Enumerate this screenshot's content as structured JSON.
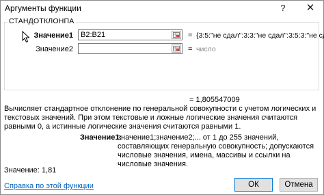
{
  "window": {
    "title": "Аргументы функции",
    "help": "?",
    "close": "✕"
  },
  "function_group": {
    "name": "СТАНДОТКЛОНПА",
    "args": [
      {
        "label": "Значение1",
        "value": "B2:B21",
        "placeholder": "",
        "preview": "{3:5:\"не сдал\":3:3:\"не сдал\":3:5:3:\"не сда"
      },
      {
        "label": "Значение2",
        "value": "",
        "placeholder": "",
        "preview": "число"
      }
    ],
    "equals": "="
  },
  "result": "= 1,805547009",
  "description": "Вычисляет стандартное отклонение по генеральной совокупности с учетом логических и текстовых значений. При этом текстовые и ложные логические значения считаются равными 0, а истинные логические значения считаются равными 1.",
  "arg_help": {
    "label": "Значение1:",
    "text": "значение1;значение2;... от 1 до 255 значений, составляющих генеральную совокупность; допускаются числовые значения, имена, массивы и ссылки на числовые значения."
  },
  "value_line": "Значение:  1,81",
  "help_link": "Справка по этой функции",
  "buttons": {
    "ok": "ОК",
    "cancel": "Отмена"
  }
}
